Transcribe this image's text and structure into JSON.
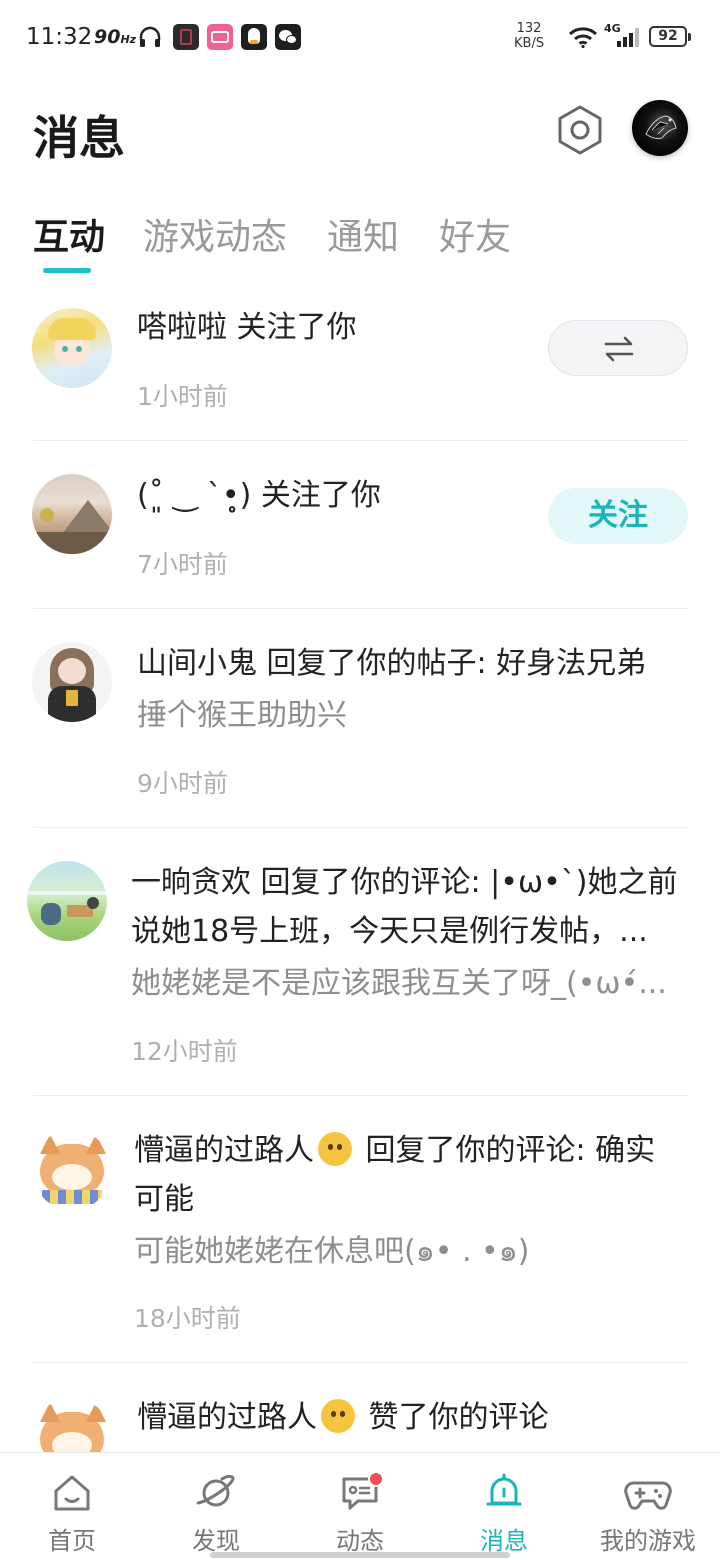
{
  "status_bar": {
    "time": "11:32",
    "refresh_rate": "90",
    "refresh_unit": "Hz",
    "net_speed_value": "132",
    "net_speed_unit": "KB/S",
    "network": "4G",
    "battery": "92"
  },
  "header": {
    "title": "消息"
  },
  "tabs": [
    {
      "label": "互动",
      "active": true
    },
    {
      "label": "游戏动态",
      "active": false
    },
    {
      "label": "通知",
      "active": false
    },
    {
      "label": "好友",
      "active": false
    }
  ],
  "messages": [
    {
      "title": "嗒啦啦 关注了你",
      "time": "1小时前",
      "action": "mutual-follow"
    },
    {
      "title": "(˚͈ ‿ ˋ•̥̥̥) 关注了你",
      "time": "7小时前",
      "action_label": "关注"
    },
    {
      "title": "山间小鬼 回复了你的帖子: 好身法兄弟",
      "subtitle": "捶个猴王助助兴",
      "time": "9小时前"
    },
    {
      "title_line1": "一晌贪欢 回复了你的评论: |•ω•`)她之前",
      "title_line2": "说她18号上班，今天只是例行发帖，...",
      "subtitle": "她姥姥是不是应该跟我互关了呀_(•ω•́...",
      "time": "12小时前"
    },
    {
      "title_prefix": "懵逼的过路人",
      "title_suffix": " 回复了你的评论: 确实",
      "title_line2": "可能",
      "subtitle": "可能她姥姥在休息吧(๑• . •๑)",
      "time": "18小时前"
    },
    {
      "title_prefix": "懵逼的过路人",
      "title_suffix": " 赞了你的评论"
    }
  ],
  "bottom_nav": [
    {
      "label": "首页",
      "icon": "home-icon"
    },
    {
      "label": "发现",
      "icon": "planet-icon"
    },
    {
      "label": "动态",
      "icon": "chat-icon",
      "badge": true
    },
    {
      "label": "消息",
      "icon": "bell-icon",
      "active": true
    },
    {
      "label": "我的游戏",
      "icon": "gamepad-icon"
    }
  ],
  "colors": {
    "accent": "#19c2c8",
    "follow_bg": "#e2f7f8",
    "badge": "#f24e4e"
  }
}
